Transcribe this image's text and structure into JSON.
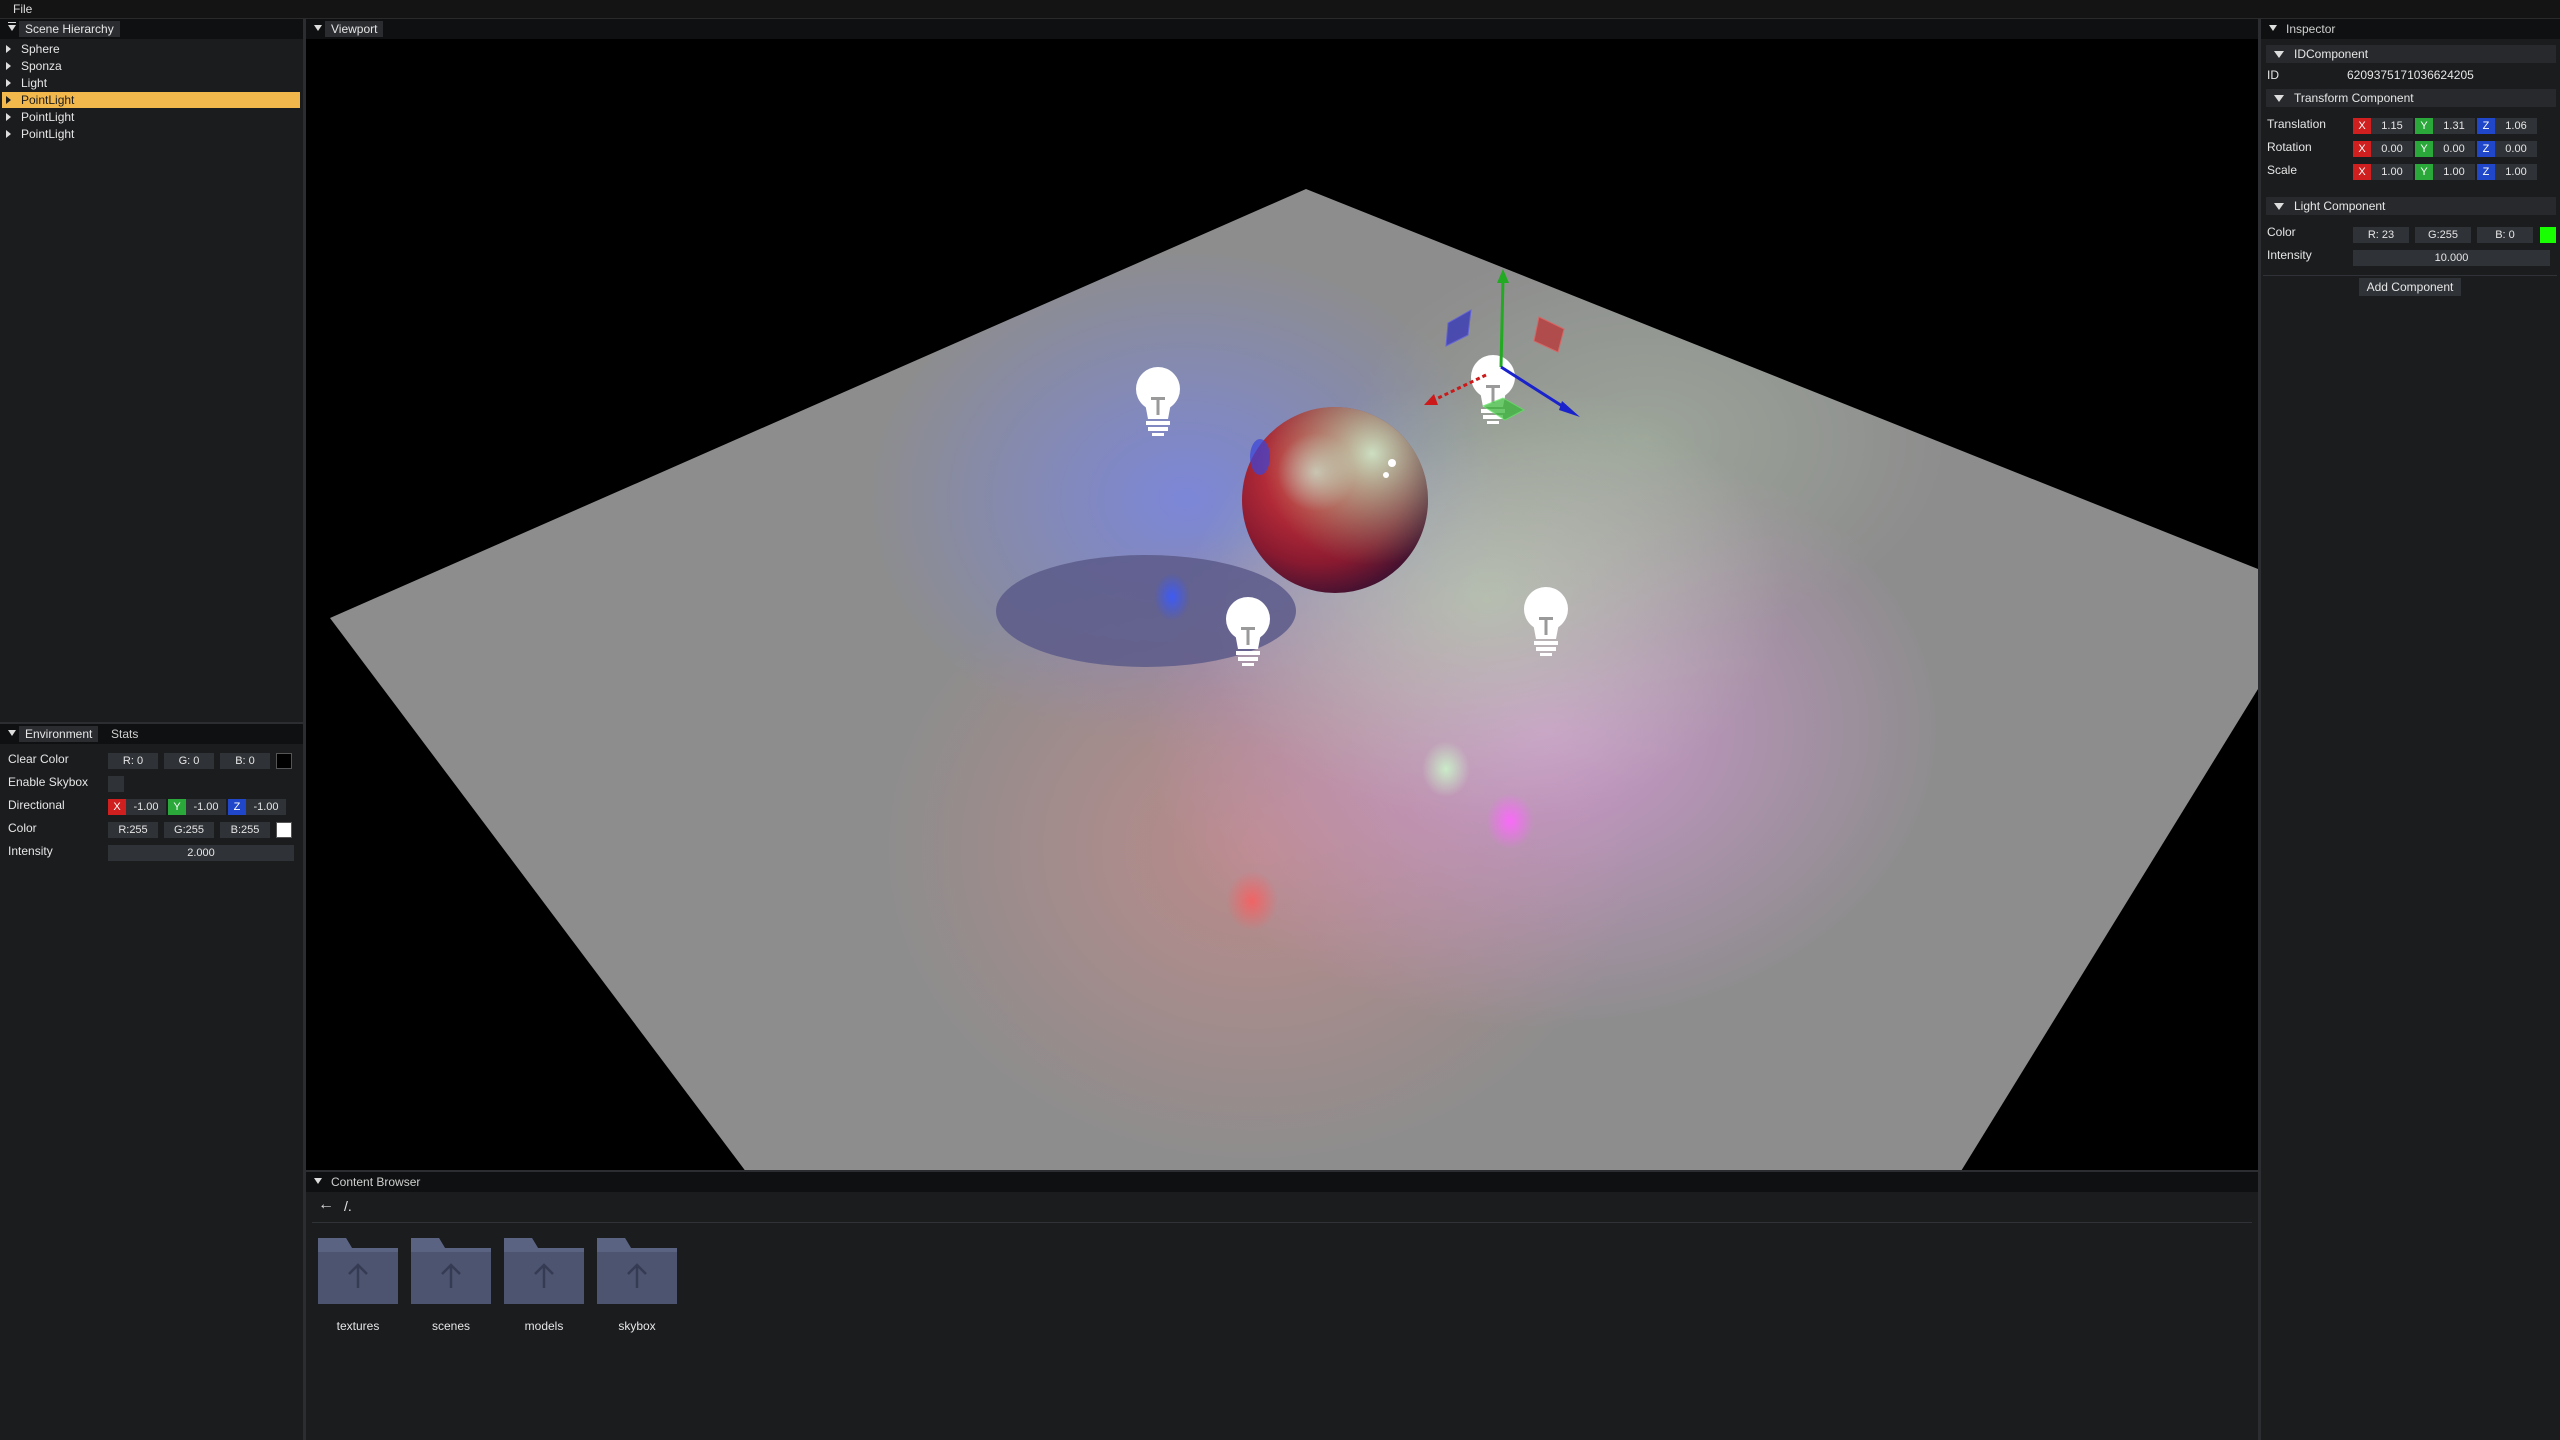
{
  "menubar": {
    "file": "File"
  },
  "hierarchy": {
    "title": "Scene Hierarchy",
    "items": [
      {
        "label": "Sphere",
        "selected": false
      },
      {
        "label": "Sponza",
        "selected": false
      },
      {
        "label": "Light",
        "selected": false
      },
      {
        "label": "PointLight",
        "selected": true
      },
      {
        "label": "PointLight",
        "selected": false
      },
      {
        "label": "PointLight",
        "selected": false
      }
    ]
  },
  "environment": {
    "tab_env": "Environment",
    "tab_stats": "Stats",
    "clear_color_label": "Clear Color",
    "clear_color": {
      "r": "R: 0",
      "g": "G: 0",
      "b": "B: 0",
      "swatch": "#000000"
    },
    "skybox_label": "Enable Skybox",
    "directional_label": "Directional",
    "directional": {
      "x": "-1.00",
      "y": "-1.00",
      "z": "-1.00"
    },
    "color_label": "Color",
    "color": {
      "r": "R:255",
      "g": "G:255",
      "b": "B:255",
      "swatch": "#ffffff"
    },
    "intensity_label": "Intensity",
    "intensity": "2.000"
  },
  "viewport": {
    "title": "Viewport"
  },
  "inspector": {
    "title": "Inspector",
    "id_component": "IDComponent",
    "id_label": "ID",
    "id_value": "6209375171036624205",
    "transform_component": "Transform Component",
    "translation_label": "Translation",
    "translation": {
      "x": "1.15",
      "y": "1.31",
      "z": "1.06"
    },
    "rotation_label": "Rotation",
    "rotation": {
      "x": "0.00",
      "y": "0.00",
      "z": "0.00"
    },
    "scale_label": "Scale",
    "scale": {
      "x": "1.00",
      "y": "1.00",
      "z": "1.00"
    },
    "light_component": "Light Component",
    "color_label": "Color",
    "color": {
      "r": "R: 23",
      "g": "G:255",
      "b": "B: 0",
      "swatch": "#17ff00"
    },
    "intensity_label": "Intensity",
    "intensity": "10.000",
    "add_component": "Add Component"
  },
  "axis_labels": {
    "x": "X",
    "y": "Y",
    "z": "Z"
  },
  "content_browser": {
    "title": "Content Browser",
    "path": "/.",
    "folders": [
      "textures",
      "scenes",
      "models",
      "skybox"
    ]
  }
}
